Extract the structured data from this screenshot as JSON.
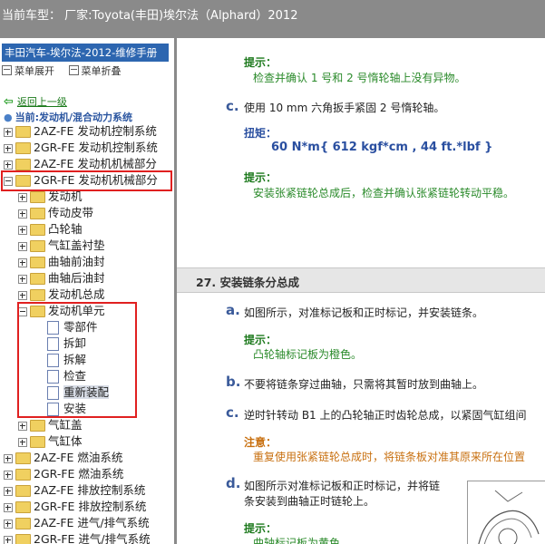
{
  "topbar": {
    "current_car": "当前车型： 厂家:Toyota(丰田)埃尔法（Alphard）2012"
  },
  "sidebar": {
    "manual_title": "丰田汽车-埃尔法-2012-维修手册",
    "expand_all": "菜单展开",
    "collapse_all": "菜单折叠",
    "back": "返回上一级",
    "current": "当前:发动机/混合动力系统",
    "tree": [
      {
        "label": "2AZ-FE 发动机控制系统"
      },
      {
        "label": "2GR-FE 发动机控制系统"
      },
      {
        "label": "2AZ-FE 发动机机械部分"
      },
      {
        "label": "2GR-FE 发动机机械部分"
      },
      {
        "label": "发动机"
      },
      {
        "label": "传动皮带"
      },
      {
        "label": "凸轮轴"
      },
      {
        "label": "气缸盖衬垫"
      },
      {
        "label": "曲轴前油封"
      },
      {
        "label": "曲轴后油封"
      },
      {
        "label": "发动机总成"
      },
      {
        "label": "发动机单元"
      },
      {
        "label": "零部件"
      },
      {
        "label": "拆卸"
      },
      {
        "label": "拆解"
      },
      {
        "label": "检查"
      },
      {
        "label": "重新装配"
      },
      {
        "label": "安装"
      },
      {
        "label": "气缸盖"
      },
      {
        "label": "气缸体"
      },
      {
        "label": "2AZ-FE 燃油系统"
      },
      {
        "label": "2GR-FE 燃油系统"
      },
      {
        "label": "2AZ-FE 排放控制系统"
      },
      {
        "label": "2GR-FE 排放控制系统"
      },
      {
        "label": "2AZ-FE 进气/排气系统"
      },
      {
        "label": "2GR-FE 进气/排气系统"
      }
    ]
  },
  "content": {
    "hint_label": "提示：",
    "hint1": "检查并确认 1 号和 2 号惰轮轴上没有异物。",
    "c1_letter": "c.",
    "c1_text": "使用 10 mm 六角扳手紧固 2 号惰轮轴。",
    "torque_label": "扭矩：",
    "torque_value": "60 N*m{ 612 kgf*cm , 44 ft.*lbf }",
    "hint2": "安装张紧链轮总成后，检查并确认张紧链轮转动平稳。",
    "section_title": "27. 安装链条分总成",
    "a_letter": "a.",
    "a_text": "如图所示，对准标记板和正时标记，并安装链条。",
    "hint_a": "凸轮轴标记板为橙色。",
    "b_letter": "b.",
    "b_text": "不要将链条穿过曲轴，只需将其暂时放到曲轴上。",
    "c2_letter": "c.",
    "c2_text": "逆时针转动 B1 上的凸轮轴正时齿轮总成，以紧固气缸组间",
    "notice_label": "注意：",
    "notice_text": "重复使用张紧链轮总成时，将链条板对准其原来所在位置",
    "d_letter": "d.",
    "d_text1": "如图所示对准标记板和正时标记，并将链",
    "d_text2": "条安装到曲轴正时链轮上。",
    "hint_d": "曲轴标记板为黄色。"
  },
  "colors": {
    "header_blue": "#2d66b0",
    "highlight_red": "#e02020",
    "hint_green": "#2a8a2a",
    "notice_orange": "#c87010"
  }
}
